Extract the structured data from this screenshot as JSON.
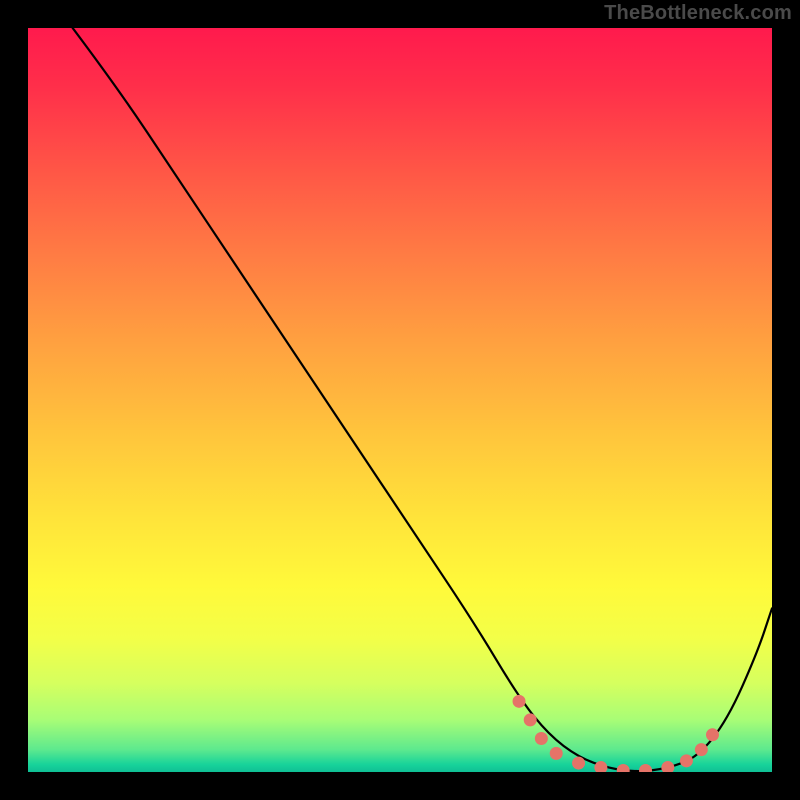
{
  "watermark": "TheBottleneck.com",
  "chart_data": {
    "type": "line",
    "title": "",
    "xlabel": "",
    "ylabel": "",
    "xlim": [
      0,
      100
    ],
    "ylim": [
      0,
      100
    ],
    "series": [
      {
        "name": "curve",
        "x": [
          6,
          12,
          20,
          28,
          36,
          44,
          52,
          60,
          66,
          70,
          74,
          78,
          82,
          86,
          90,
          94,
          98,
          100
        ],
        "y": [
          100,
          92,
          80,
          68,
          56,
          44,
          32,
          20,
          10,
          5,
          2,
          0.5,
          0,
          0.5,
          2,
          7,
          16,
          22
        ]
      }
    ],
    "markers": {
      "name": "salmon-dots",
      "color": "#e57368",
      "points": [
        {
          "x": 66,
          "y": 9.5
        },
        {
          "x": 67.5,
          "y": 7
        },
        {
          "x": 69,
          "y": 4.5
        },
        {
          "x": 71,
          "y": 2.5
        },
        {
          "x": 74,
          "y": 1.2
        },
        {
          "x": 77,
          "y": 0.6
        },
        {
          "x": 80,
          "y": 0.2
        },
        {
          "x": 83,
          "y": 0.2
        },
        {
          "x": 86,
          "y": 0.6
        },
        {
          "x": 88.5,
          "y": 1.5
        },
        {
          "x": 90.5,
          "y": 3
        },
        {
          "x": 92,
          "y": 5
        }
      ]
    },
    "background": {
      "type": "vertical-gradient",
      "stops": [
        {
          "pos": 0.0,
          "color": "#ff1a4d"
        },
        {
          "pos": 0.2,
          "color": "#ff5946"
        },
        {
          "pos": 0.42,
          "color": "#ffa040"
        },
        {
          "pos": 0.66,
          "color": "#ffe43a"
        },
        {
          "pos": 0.82,
          "color": "#f3ff48"
        },
        {
          "pos": 0.93,
          "color": "#a8fd76"
        },
        {
          "pos": 1.0,
          "color": "#0fbf95"
        }
      ]
    }
  }
}
